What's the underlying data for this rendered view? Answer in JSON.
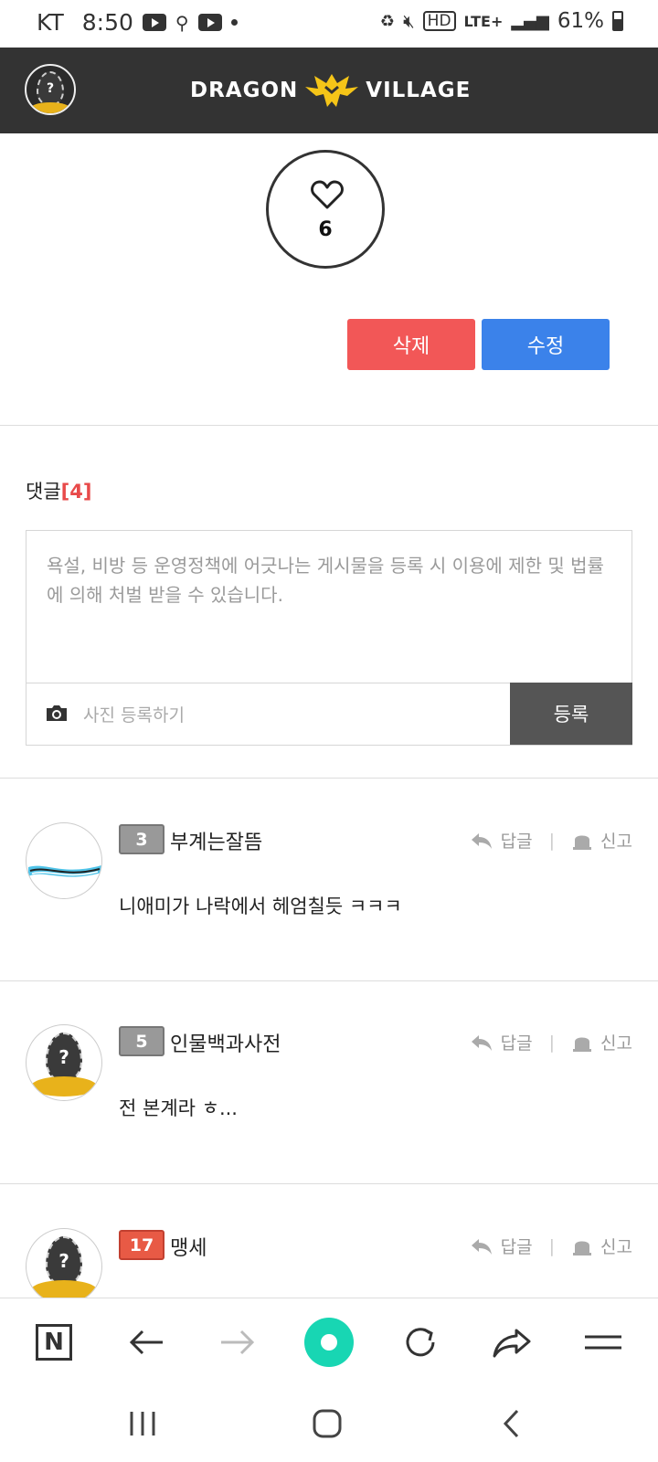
{
  "status_bar": {
    "carrier": "KT",
    "time": "8:50",
    "network": "LTE+",
    "battery": "61%"
  },
  "header": {
    "logo_left": "DRAGON",
    "logo_right": "VILLAGE",
    "avatar_glyph": "?"
  },
  "post": {
    "like_count": "6",
    "delete_label": "삭제",
    "edit_label": "수정"
  },
  "comments_section": {
    "title": "댓글",
    "count": "[4]",
    "placeholder": "욕설, 비방 등 운영정책에 어긋나는 게시물을 등록 시 이용에 제한 및 법률에 의해 처벌 받을 수 있습니다.",
    "photo_label": "사진 등록하기",
    "submit_label": "등록"
  },
  "comment_actions": {
    "reply": "답글",
    "report": "신고"
  },
  "comments": [
    {
      "level": "3",
      "name": "부계는잘뜸",
      "text": "니애미가 나락에서 헤엄칠듯 ㅋㅋㅋ"
    },
    {
      "level": "5",
      "name": "인물백과사전",
      "text": "전 본계라 ㅎ...",
      "avatar_glyph": "?"
    },
    {
      "level": "17",
      "name": "맹세",
      "text": "",
      "avatar_glyph": "?"
    }
  ],
  "browser_bar": {
    "home_letter": "N"
  },
  "colors": {
    "header_bg": "#333333",
    "delete": "#f25757",
    "edit": "#3b82ea",
    "count": "#e84a4a",
    "submit": "#555555",
    "center_button": "#18d6b3"
  }
}
